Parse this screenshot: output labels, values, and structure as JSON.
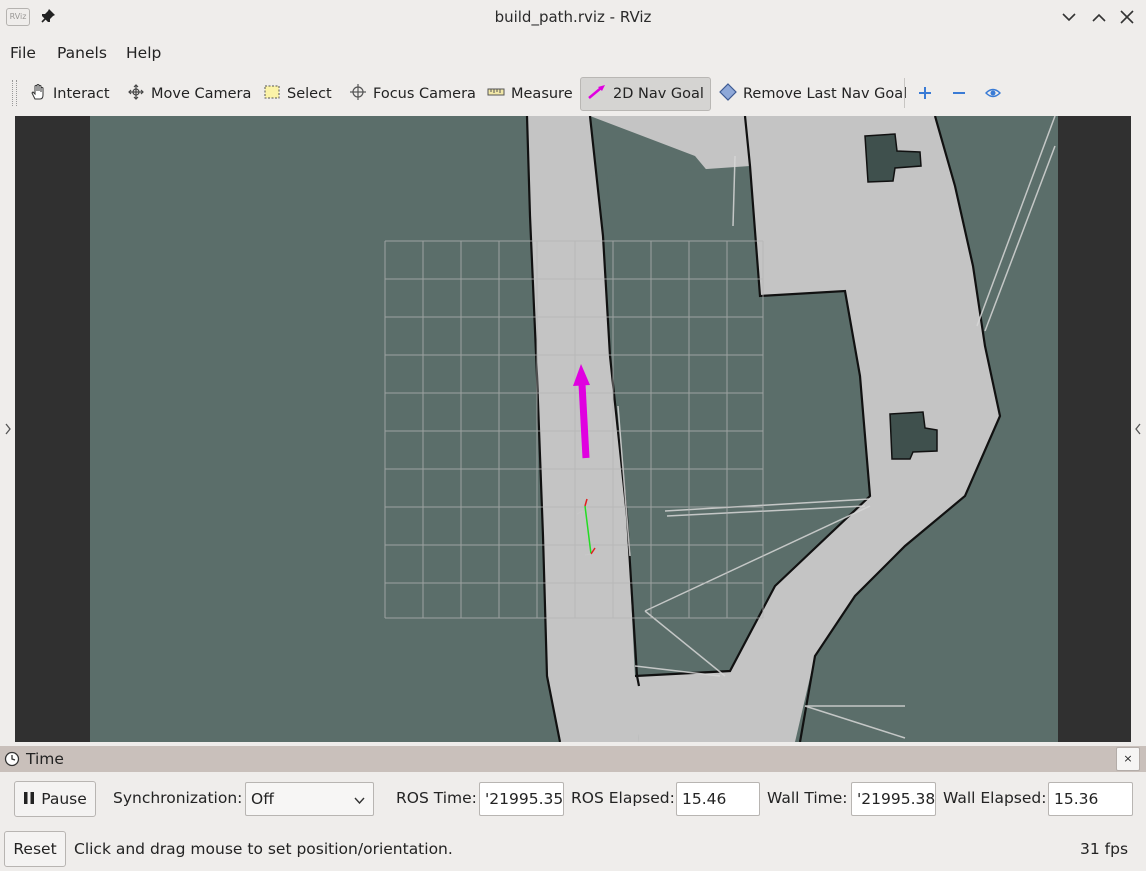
{
  "window": {
    "title": "build_path.rviz - RViz",
    "app_badge": "RViz"
  },
  "menu": [
    {
      "label": "File"
    },
    {
      "label": "Panels"
    },
    {
      "label": "Help"
    }
  ],
  "toolbar": {
    "tools": [
      {
        "label": "Interact",
        "icon": "hand-icon",
        "active": false
      },
      {
        "label": "Move Camera",
        "icon": "move-camera-icon",
        "active": false
      },
      {
        "label": "Select",
        "icon": "select-box-icon",
        "active": false
      },
      {
        "label": "Focus Camera",
        "icon": "crosshair-icon",
        "active": false
      },
      {
        "label": "Measure",
        "icon": "ruler-icon",
        "active": false
      },
      {
        "label": "2D Nav Goal",
        "icon": "nav-goal-arrow-icon",
        "active": true
      },
      {
        "label": "Remove Last Nav Goal",
        "icon": "diamond-icon",
        "active": false
      }
    ],
    "extra_icons": [
      "plus-icon",
      "minus-icon",
      "eye-icon"
    ]
  },
  "colors": {
    "map_unknown": "#5b6e6a",
    "map_free": "#c4c4c4",
    "map_wall": "#111111",
    "nav_goal_arrow": "#e000e0",
    "viewport_bg": "#303030",
    "accent_blue": "#3a7bd5"
  },
  "time_panel": {
    "title": "Time",
    "close_symbol": "×",
    "pause_label": "Pause",
    "sync_label": "Synchronization:",
    "sync_value": "Off",
    "ros_time_label": "ROS Time:",
    "ros_time_value": "'21995.35",
    "ros_elapsed_label": "ROS Elapsed:",
    "ros_elapsed_value": "15.46",
    "wall_time_label": "Wall Time:",
    "wall_time_value": "'21995.38",
    "wall_elapsed_label": "Wall Elapsed:",
    "wall_elapsed_value": "15.36"
  },
  "status_bar": {
    "reset_label": "Reset",
    "message": "Click and drag mouse to set position/orientation.",
    "fps": "31 fps"
  }
}
